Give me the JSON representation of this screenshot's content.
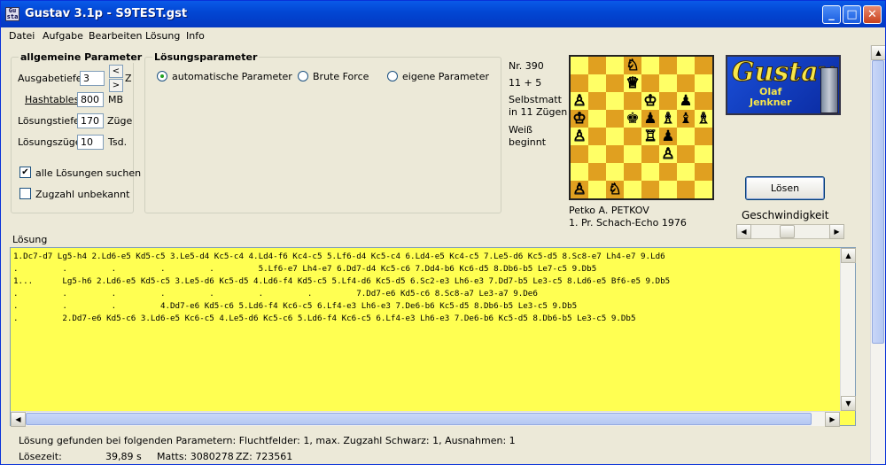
{
  "window": {
    "app_title": "Gustav 3.1p - S9TEST.gst",
    "icon_text": "Gu\nsta"
  },
  "menu": [
    "Datei",
    "Aufgabe",
    "Bearbeiten",
    "Lösung",
    "Info"
  ],
  "general": {
    "title": "allgemeine Parameter",
    "ausgabetiefe": {
      "label": "Ausgabetiefe",
      "value": "3",
      "unit": "Züge"
    },
    "hashtables": {
      "label": "Hashtables",
      "value": "800",
      "unit": "MB"
    },
    "loesungstiefe": {
      "label": "Lösungstiefe",
      "value": "170",
      "unit": "Züge"
    },
    "loesungszuege": {
      "label": "Lösungszüge",
      "value": "10",
      "unit": "Tsd."
    },
    "alle_loesungen": {
      "label": "alle Lösungen suchen",
      "checked": true
    },
    "zugzahl": {
      "label": "Zugzahl unbekannt",
      "checked": false
    }
  },
  "solution_params": {
    "title": "Lösungsparameter",
    "options": [
      {
        "label": "automatische Parameter",
        "selected": true
      },
      {
        "label": "Brute Force",
        "selected": false
      },
      {
        "label": "eigene Parameter",
        "selected": false
      }
    ]
  },
  "problem": {
    "number": "Nr. 390",
    "pieces": "11 + 5",
    "stipulation_1": "Selbstmatt",
    "stipulation_2": "in 11 Zügen",
    "side_1": "Weiß",
    "side_2": "beginnt",
    "author": "Petko A. PETKOV",
    "source": "1. Pr. Schach-Echo 1976"
  },
  "board": {
    "light_color": "#ffff66",
    "dark_color": "#e0a020",
    "pieces": [
      {
        "sq": "d8",
        "p": "♘",
        "c": "w"
      },
      {
        "sq": "d7",
        "p": "♕",
        "c": "w"
      },
      {
        "sq": "a6",
        "p": "♙",
        "c": "w"
      },
      {
        "sq": "e6",
        "p": "♔",
        "c": "w"
      },
      {
        "sq": "g6",
        "p": "♟",
        "c": "b"
      },
      {
        "sq": "a5",
        "p": "♔",
        "c": "w"
      },
      {
        "sq": "d5",
        "p": "♚",
        "c": "b"
      },
      {
        "sq": "e5",
        "p": "♟",
        "c": "b"
      },
      {
        "sq": "f5",
        "p": "♗",
        "c": "w"
      },
      {
        "sq": "g5",
        "p": "♝",
        "c": "b"
      },
      {
        "sq": "h5",
        "p": "♗",
        "c": "w"
      },
      {
        "sq": "a4",
        "p": "♙",
        "c": "w"
      },
      {
        "sq": "e4",
        "p": "♖",
        "c": "w"
      },
      {
        "sq": "f4",
        "p": "♟",
        "c": "b"
      },
      {
        "sq": "f3",
        "p": "♙",
        "c": "w"
      },
      {
        "sq": "a1",
        "p": "♙",
        "c": "w"
      },
      {
        "sq": "c1",
        "p": "♘",
        "c": "w"
      }
    ]
  },
  "logo": {
    "title": "Gustav",
    "line1": "Olaf",
    "line2": "Jenkner"
  },
  "solve_button": "Lösen",
  "speed": {
    "label": "Geschwindigkeit",
    "level": 0.45
  },
  "solution": {
    "label": "Lösung",
    "lines": [
      "1.Dc7-d7 Lg5-h4 2.Ld6-e5 Kd5-c5 3.Le5-d4 Kc5-c4 4.Ld4-f6 Kc4-c5 5.Lf6-d4 Kc5-c4 6.Ld4-e5 Kc4-c5 7.Le5-d6 Kc5-d5 8.Sc8-e7 Lh4-e7 9.Ld6",
      ".         .         .         .         .         5.Lf6-e7 Lh4-e7 6.Dd7-d4 Kc5-c6 7.Dd4-b6 Kc6-d5 8.Db6-b5 Le7-c5 9.Db5",
      "1...      Lg5-h6 2.Ld6-e5 Kd5-c5 3.Le5-d6 Kc5-d5 4.Ld6-f4 Kd5-c5 5.Lf4-d6 Kc5-d5 6.Sc2-e3 Lh6-e3 7.Dd7-b5 Le3-c5 8.Ld6-e5 Bf6-e5 9.Db5",
      ".         .         .         .         .         .         .         7.Dd7-e6 Kd5-c6 8.Sc8-a7 Le3-a7 9.De6",
      ".         .         .         4.Dd7-e6 Kd5-c6 5.Ld6-f4 Kc6-c5 6.Lf4-e3 Lh6-e3 7.De6-b6 Kc5-d5 8.Db6-b5 Le3-c5 9.Db5",
      ".         2.Dd7-e6 Kd5-c6 3.Ld6-e5 Kc6-c5 4.Le5-d6 Kc5-c6 5.Ld6-f4 Kc6-c5 6.Lf4-e3 Lh6-e3 7.De6-b6 Kc5-d5 8.Db6-b5 Le3-c5 9.Db5"
    ]
  },
  "status": {
    "line1": "Lösung gefunden bei folgenden Parametern: Fluchtfelder: 1, max. Zugzahl Schwarz: 1, Ausnahmen: 1",
    "time_label": "Lösezeit:",
    "time_value": "39,89 s",
    "matts": "Matts: 3080278",
    "zz": "ZZ: 723561"
  }
}
